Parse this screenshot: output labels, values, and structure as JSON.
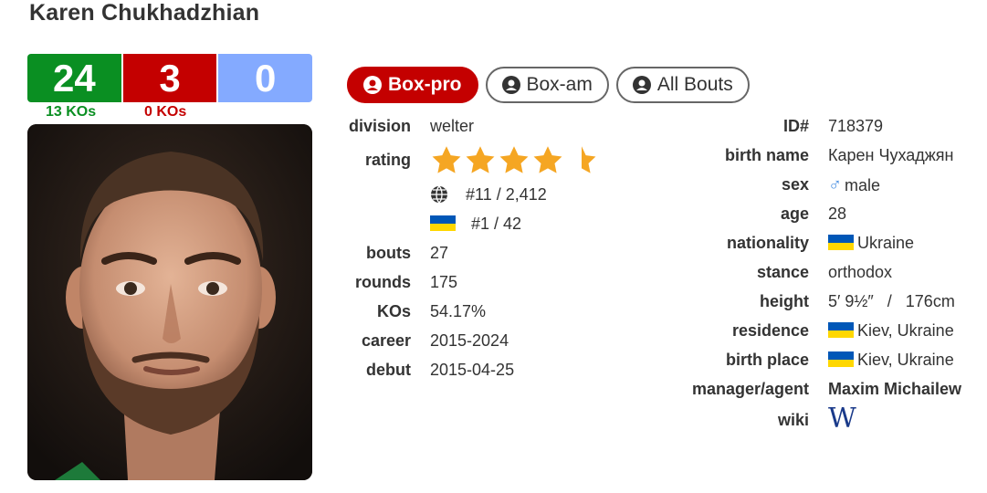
{
  "boxer": {
    "name": "Karen Chukhadzhian"
  },
  "record": {
    "wins": "24",
    "losses": "3",
    "draws": "0",
    "wins_kos": "13 KOs",
    "losses_kos": "0 KOs",
    "colors": {
      "win": "#0a8f22",
      "loss": "#c40000",
      "draw": "#84aaff"
    }
  },
  "tabs": [
    {
      "label": "Box-pro",
      "active": true
    },
    {
      "label": "Box-am",
      "active": false
    },
    {
      "label": "All Bouts",
      "active": false
    }
  ],
  "left_info": {
    "division": {
      "label": "division",
      "value": "welter"
    },
    "rating": {
      "label": "rating",
      "stars": 4.5,
      "max_stars": 5,
      "world_rank": "#11 / 2,412",
      "country_rank": "#1 / 42"
    },
    "bouts": {
      "label": "bouts",
      "value": "27"
    },
    "rounds": {
      "label": "rounds",
      "value": "175"
    },
    "kos": {
      "label": "KOs",
      "value": "54.17%"
    },
    "career": {
      "label": "career",
      "value": "2015-2024"
    },
    "debut": {
      "label": "debut",
      "value": "2015-04-25"
    }
  },
  "right_info": {
    "id": {
      "label": "ID#",
      "value": "718379"
    },
    "birth_name": {
      "label": "birth name",
      "value": "Карен Чухаджян"
    },
    "sex": {
      "label": "sex",
      "value": "male",
      "icon": "male-icon"
    },
    "age": {
      "label": "age",
      "value": "28"
    },
    "nationality": {
      "label": "nationality",
      "value": "Ukraine",
      "icon": "ukraine-flag-icon"
    },
    "stance": {
      "label": "stance",
      "value": "orthodox"
    },
    "height": {
      "label": "height",
      "value": "5′ 9½″   /   176cm"
    },
    "residence": {
      "label": "residence",
      "value": "Kiev, Ukraine"
    },
    "birth_place": {
      "label": "birth place",
      "value": "Kiev, Ukraine"
    },
    "manager": {
      "label": "manager/agent",
      "value": "Maxim Michailew"
    },
    "wiki": {
      "label": "wiki",
      "icon": "wikipedia-icon"
    }
  },
  "colors": {
    "star": "#f5a623",
    "flag_blue": "#0057b7",
    "flag_yellow": "#ffd700",
    "sex_icon": "#4a90e2"
  }
}
